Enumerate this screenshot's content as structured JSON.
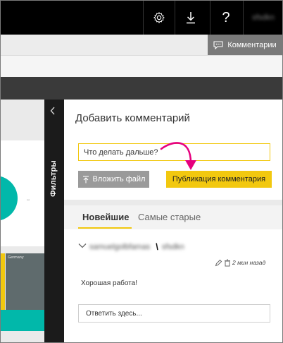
{
  "topbar": {
    "settings_icon": "gear-icon",
    "download_icon": "download-icon",
    "help_label": "?",
    "user_name_blurred": "sfsdkn"
  },
  "toolbar": {
    "comments_label": "Комментарии",
    "comments_icon": "comment-icon"
  },
  "canvas": {
    "tile_label": "Germany"
  },
  "filters": {
    "label": "Фильтры",
    "collapse_icon": "chevron-left-icon"
  },
  "comments": {
    "title": "Добавить комментарий",
    "input_value": "Что делать дальше?",
    "upload_label": "Вложить файл",
    "publish_label": "Публикация комментария",
    "tabs": [
      {
        "label": "Новейшие",
        "active": true
      },
      {
        "label": "Самые старые",
        "active": false
      }
    ],
    "thread": {
      "author_part1": "samuelgolbfamas ",
      "author_part2": "sfsdkn",
      "time": "2 мин назад",
      "text": "Хорошая работа!",
      "reply_placeholder": "Ответить здесь..."
    }
  },
  "colors": {
    "accent_yellow": "#f2c80f",
    "teal": "#01b8aa",
    "annotation_arrow": "#e6007e"
  }
}
